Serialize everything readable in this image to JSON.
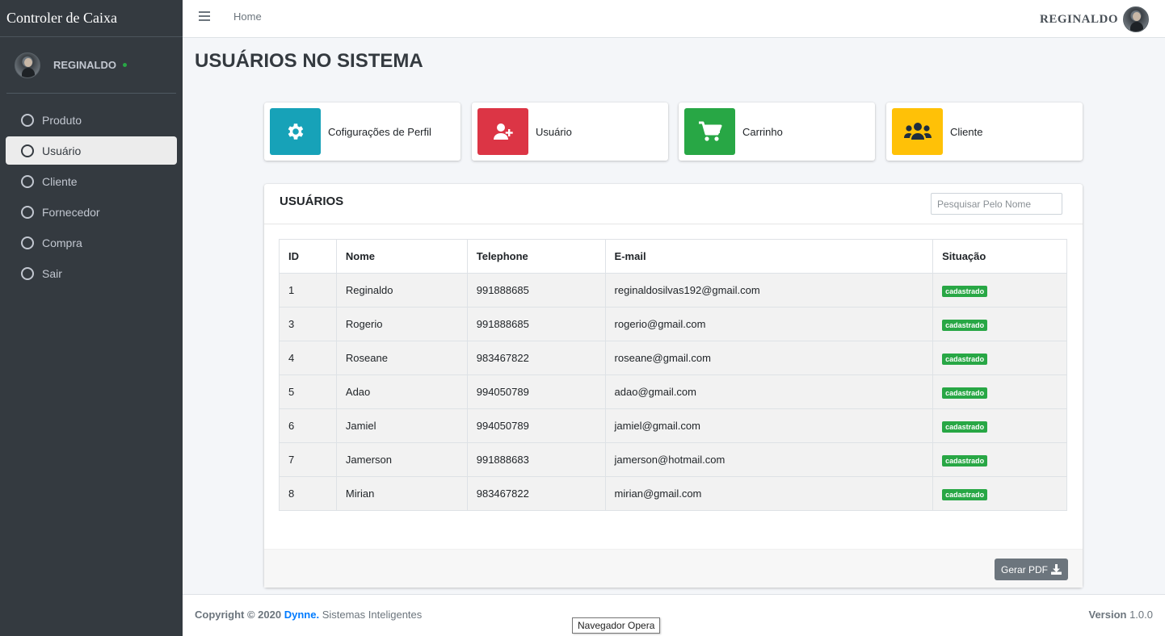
{
  "app": {
    "brand": "Controler de Caixa"
  },
  "sidebar": {
    "user": "REGINALDO",
    "items": [
      {
        "label": "Produto",
        "active": false
      },
      {
        "label": "Usuário",
        "active": true
      },
      {
        "label": "Cliente",
        "active": false
      },
      {
        "label": "Fornecedor",
        "active": false
      },
      {
        "label": "Compra",
        "active": false
      },
      {
        "label": "Sair",
        "active": false
      }
    ]
  },
  "topbar": {
    "home": "Home",
    "user": "REGINALDO"
  },
  "page": {
    "title": "USUÁRIOS NO SISTEMA"
  },
  "info_boxes": [
    {
      "label": "Cofigurações de Perfil",
      "icon": "gear-icon",
      "color": "#17a2b8"
    },
    {
      "label": "Usuário",
      "icon": "user-plus-icon",
      "color": "#dc3545"
    },
    {
      "label": "Carrinho",
      "icon": "cart-icon",
      "color": "#28a745"
    },
    {
      "label": "Cliente",
      "icon": "users-icon",
      "color": "#ffc107"
    }
  ],
  "users_card": {
    "title": "USUÁRIOS",
    "search_placeholder": "Pesquisar Pelo Nome",
    "columns": [
      "ID",
      "Nome",
      "Telephone",
      "E-mail",
      "Situação"
    ],
    "rows": [
      {
        "id": "1",
        "nome": "Reginaldo",
        "telephone": "991888685",
        "email": "reginaldosilvas192@gmail.com",
        "situacao": "cadastrado"
      },
      {
        "id": "3",
        "nome": "Rogerio",
        "telephone": "991888685",
        "email": "rogerio@gmail.com",
        "situacao": "cadastrado"
      },
      {
        "id": "4",
        "nome": "Roseane",
        "telephone": "983467822",
        "email": "roseane@gmail.com",
        "situacao": "cadastrado"
      },
      {
        "id": "5",
        "nome": "Adao",
        "telephone": "994050789",
        "email": "adao@gmail.com",
        "situacao": "cadastrado"
      },
      {
        "id": "6",
        "nome": "Jamiel",
        "telephone": "994050789",
        "email": "jamiel@gmail.com",
        "situacao": "cadastrado"
      },
      {
        "id": "7",
        "nome": "Jamerson",
        "telephone": "991888683",
        "email": "jamerson@hotmail.com",
        "situacao": "cadastrado"
      },
      {
        "id": "8",
        "nome": "Mirian",
        "telephone": "983467822",
        "email": "mirian@gmail.com",
        "situacao": "cadastrado"
      }
    ],
    "pdf_button": "Gerar PDF"
  },
  "footer": {
    "copyright_prefix": "Copyright © 2020",
    "brand": "Dynne.",
    "suffix": "Sistemas Inteligentes",
    "version_label": "Version",
    "version": "1.0.0"
  },
  "tooltip": "Navegador Opera",
  "colors": {
    "sidebar": "#343a40",
    "badge": "#28a745",
    "link": "#007bff"
  }
}
